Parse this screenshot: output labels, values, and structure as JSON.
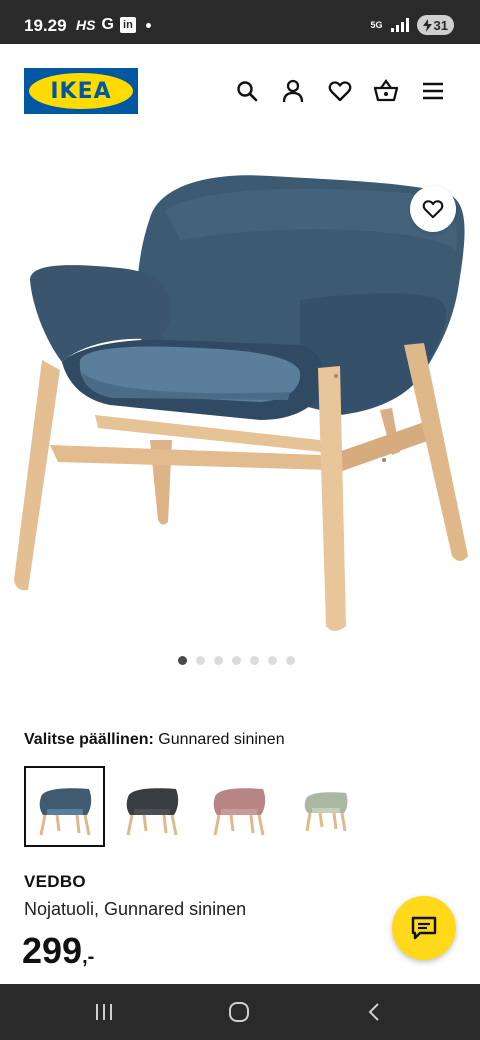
{
  "status_bar": {
    "time": "19.29",
    "app_icons": [
      "HS",
      "G",
      "in"
    ],
    "network": "5G",
    "battery": "31"
  },
  "header": {
    "logo_text": "IKEA",
    "icons": [
      "search-icon",
      "profile-icon",
      "favourites-icon",
      "cart-icon",
      "menu-icon"
    ]
  },
  "gallery": {
    "image_count": 7,
    "active_index": 0
  },
  "selection": {
    "label": "Valitse päällinen:",
    "value": "Gunnared sininen",
    "swatches": [
      {
        "color": "#3f5b72",
        "selected": true
      },
      {
        "color": "#3a3d40",
        "selected": false
      },
      {
        "color": "#b88585",
        "selected": false
      },
      {
        "color": "#aab8a2",
        "selected": false
      }
    ]
  },
  "product": {
    "name": "VEDBO",
    "description": "Nojatuoli, Gunnared sininen",
    "price": "299",
    "price_suffix": ",-"
  },
  "colors": {
    "ikea_blue": "#0058a3",
    "ikea_yellow": "#ffdb00",
    "chat_yellow": "#ffd91a"
  }
}
